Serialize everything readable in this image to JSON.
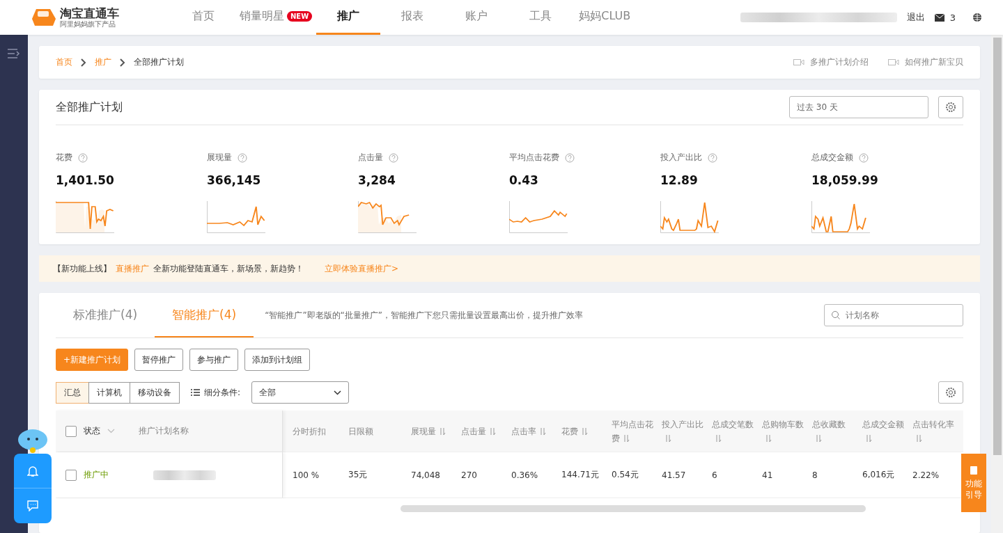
{
  "logo": {
    "title": "淘宝直通车",
    "subtitle": "阿里妈妈旗下产品"
  },
  "nav": [
    {
      "label": "首页",
      "selected": false
    },
    {
      "label": "销量明星",
      "selected": false,
      "badge": "NEW"
    },
    {
      "label": "推广",
      "selected": true
    },
    {
      "label": "报表",
      "selected": false
    },
    {
      "label": "账户",
      "selected": false
    },
    {
      "label": "工具",
      "selected": false
    },
    {
      "label": "妈妈CLUB",
      "selected": false
    }
  ],
  "header_right": {
    "logout": "退出",
    "messages": "3"
  },
  "breadcrumb": [
    {
      "label": "首页",
      "link": true
    },
    {
      "label": "推广",
      "link": true
    },
    {
      "label": "全部推广计划",
      "link": false
    }
  ],
  "help_links": [
    "多推广计划介绍",
    "如何推广新宝贝"
  ],
  "overview": {
    "title": "全部推广计划",
    "date_range": "过去 30 天",
    "metrics": [
      {
        "label": "花费",
        "value": "1,401.50"
      },
      {
        "label": "展现量",
        "value": "366,145"
      },
      {
        "label": "点击量",
        "value": "3,284"
      },
      {
        "label": "平均点击花费",
        "value": "0.43"
      },
      {
        "label": "投入产出比",
        "value": "12.89"
      },
      {
        "label": "总成交金额",
        "value": "18,059.99"
      }
    ]
  },
  "banner": {
    "prefix": "【新功能上线】",
    "highlight": "直播推广",
    "text": "全新功能登陆直通车，新场景，新趋势！",
    "link": "立即体验直播推广>"
  },
  "plan_tabs": [
    {
      "label": "标准推广(4)",
      "selected": false
    },
    {
      "label": "智能推广(4)",
      "selected": true
    }
  ],
  "plan_tip": "“智能推广”即老版的“批量推广”，智能推广下您只需批量设置最高出价，提升推广效率",
  "search": {
    "placeholder": "计划名称"
  },
  "actions": [
    {
      "label": "+新建推广计划",
      "kind": "primary"
    },
    {
      "label": "暂停推广",
      "kind": "default"
    },
    {
      "label": "参与推广",
      "kind": "default"
    },
    {
      "label": "添加到计划组",
      "kind": "default"
    }
  ],
  "device_tabs": [
    {
      "label": "汇总",
      "selected": true
    },
    {
      "label": "计算机",
      "selected": false
    },
    {
      "label": "移动设备",
      "selected": false
    }
  ],
  "filter": {
    "label": "细分条件:",
    "value": "全部"
  },
  "table": {
    "select_all_checked": false,
    "fixed_columns": [
      "状态",
      "推广计划名称"
    ],
    "columns": [
      {
        "label": "分时折扣",
        "sortable": false
      },
      {
        "label": "日限额",
        "sortable": false
      },
      {
        "label": "展现量",
        "sortable": true
      },
      {
        "label": "点击量",
        "sortable": true
      },
      {
        "label": "点击率",
        "sortable": true
      },
      {
        "label": "花费",
        "sortable": true
      },
      {
        "label": "平均点击花费",
        "sortable": true
      },
      {
        "label": "投入产出比",
        "sortable": true
      },
      {
        "label": "总成交笔数",
        "sortable": true
      },
      {
        "label": "总购物车数",
        "sortable": true
      },
      {
        "label": "总收藏数",
        "sortable": true
      },
      {
        "label": "总成交金额",
        "sortable": true
      },
      {
        "label": "点击转化率",
        "sortable": true
      }
    ],
    "rows": [
      {
        "checked": false,
        "status": "推广中",
        "cells": [
          "100 %",
          "35元",
          "74,048",
          "270",
          "0.36%",
          "144.71元",
          "0.54元",
          "41.57",
          "6",
          "41",
          "8",
          "6,016元",
          "2.22%"
        ]
      }
    ]
  },
  "guide_button": "功能引导"
}
